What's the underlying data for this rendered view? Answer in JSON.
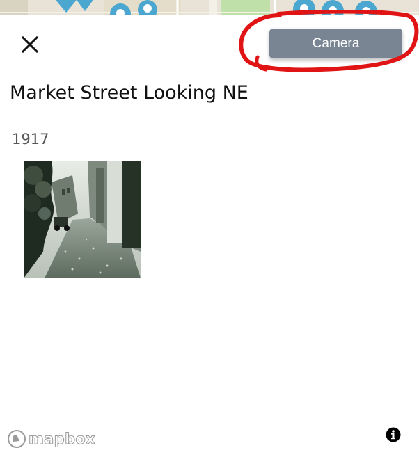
{
  "popup": {
    "title": "Market Street Looking NE",
    "year": "1917",
    "camera_label": "Camera"
  },
  "attribution": {
    "brand": "mapbox"
  },
  "icons": {
    "close": "close-icon",
    "info": "info-icon",
    "mapbox_logo": "mapbox-logo-icon",
    "map_marker": "map-pin-icon"
  },
  "colors": {
    "camera_button": "#7a8594",
    "annotation": "#e01414",
    "marker": "#4ba7cf"
  }
}
